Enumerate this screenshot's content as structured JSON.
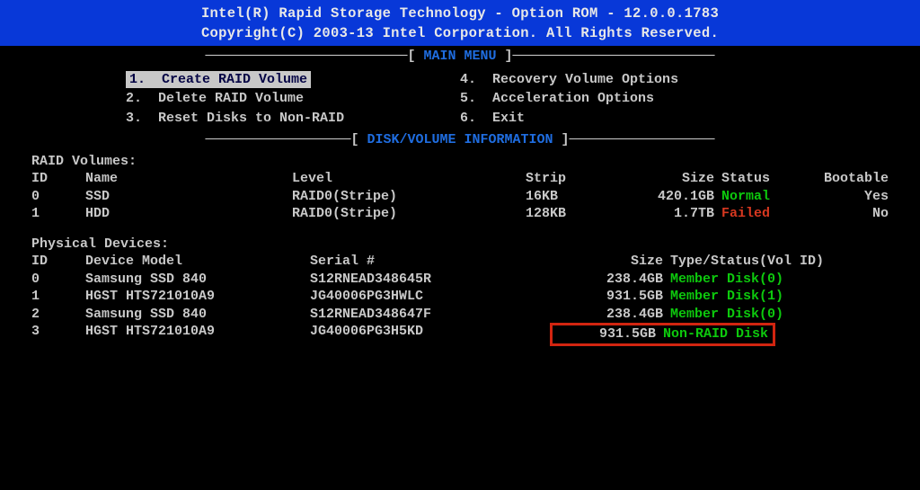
{
  "header": {
    "title": "Intel(R) Rapid Storage Technology - Option ROM - 12.0.0.1783",
    "copyright": "Copyright(C) 2003-13 Intel Corporation.  All Rights Reserved."
  },
  "main_menu": {
    "title": "MAIN MENU",
    "bracket_left": "=========================[ ",
    "bracket_right": " ]=========================",
    "items": [
      {
        "num": "1.",
        "label": "Create RAID Volume",
        "selected": true
      },
      {
        "num": "2.",
        "label": "Delete RAID Volume",
        "selected": false
      },
      {
        "num": "3.",
        "label": "Reset Disks to Non-RAID",
        "selected": false
      },
      {
        "num": "4.",
        "label": "Recovery Volume Options",
        "selected": false
      },
      {
        "num": "5.",
        "label": "Acceleration Options",
        "selected": false
      },
      {
        "num": "6.",
        "label": "Exit",
        "selected": false
      }
    ]
  },
  "disk_info": {
    "title": "DISK/VOLUME INFORMATION",
    "raid_volumes_label": "RAID Volumes:",
    "raid_headers": {
      "id": "ID",
      "name": "Name",
      "level": "Level",
      "strip": "Strip",
      "size": "Size",
      "status": "Status",
      "bootable": "Bootable"
    },
    "raid_volumes": [
      {
        "id": "0",
        "name": "SSD",
        "level": "RAID0(Stripe)",
        "strip": "16KB",
        "size": "420.1GB",
        "status": "Normal",
        "status_class": "green",
        "bootable": "Yes"
      },
      {
        "id": "1",
        "name": "HDD",
        "level": "RAID0(Stripe)",
        "strip": "128KB",
        "size": "1.7TB",
        "status": "Failed",
        "status_class": "red",
        "bootable": "No"
      }
    ],
    "physical_label": "Physical Devices:",
    "physical_headers": {
      "id": "ID",
      "model": "Device Model",
      "serial": "Serial #",
      "size": "Size",
      "status": "Type/Status(Vol ID)"
    },
    "physical_devices": [
      {
        "id": "0",
        "model": "Samsung SSD 840",
        "serial": "S12RNEAD348645R",
        "size": "238.4GB",
        "status": "Member Disk(0)",
        "highlighted": false
      },
      {
        "id": "1",
        "model": "HGST HTS721010A9",
        "serial": "JG40006PG3HWLC",
        "size": "931.5GB",
        "status": "Member Disk(1)",
        "highlighted": false
      },
      {
        "id": "2",
        "model": "Samsung SSD 840",
        "serial": "S12RNEAD348647F",
        "size": "238.4GB",
        "status": "Member Disk(0)",
        "highlighted": false
      },
      {
        "id": "3",
        "model": "HGST HTS721010A9",
        "serial": "JG40006PG3H5KD",
        "size": "931.5GB",
        "status": "Non-RAID Disk",
        "highlighted": true
      }
    ]
  }
}
